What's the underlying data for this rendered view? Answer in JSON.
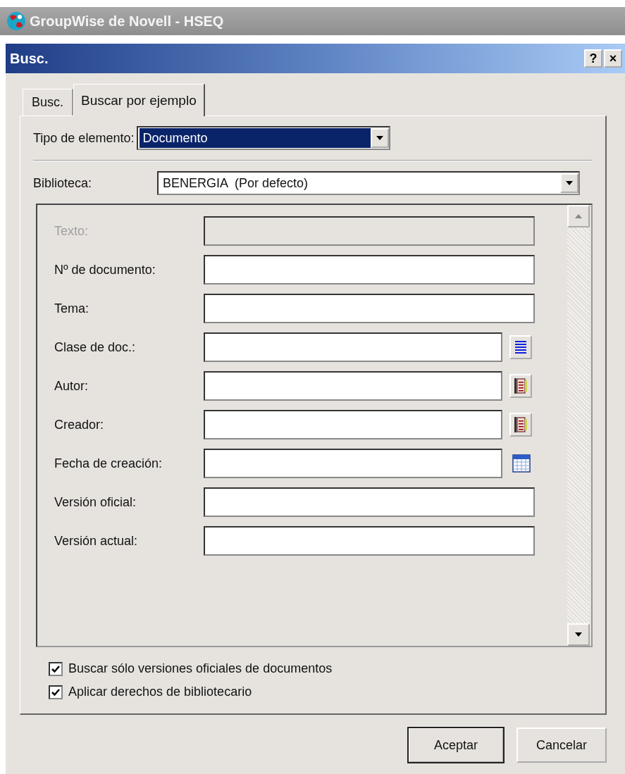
{
  "app_title": "GroupWise de Novell - HSEQ",
  "dialog": {
    "title": "Busc.",
    "help": "?",
    "close": "×"
  },
  "tabs": [
    {
      "label": "Busc.",
      "selected": false
    },
    {
      "label": "Buscar por ejemplo",
      "selected": true
    }
  ],
  "item_type": {
    "label": "Tipo de elemento:",
    "value": "Documento"
  },
  "library": {
    "label": "Biblioteca:",
    "value": "BENERGIA  (Por defecto)"
  },
  "fields": [
    {
      "label": "Texto:",
      "kind": "plain",
      "disabled": true
    },
    {
      "label": "Nº de documento:",
      "kind": "plain",
      "disabled": false
    },
    {
      "label": "Tema:",
      "kind": "plain",
      "disabled": false
    },
    {
      "label": "Clase de doc.:",
      "kind": "list",
      "disabled": false
    },
    {
      "label": "Autor:",
      "kind": "book",
      "disabled": false
    },
    {
      "label": "Creador:",
      "kind": "book",
      "disabled": false
    },
    {
      "label": "Fecha de creación:",
      "kind": "calendar",
      "disabled": false
    },
    {
      "label": "Versión oficial:",
      "kind": "plain",
      "disabled": false
    },
    {
      "label": "Versión actual:",
      "kind": "plain",
      "disabled": false
    }
  ],
  "options": [
    {
      "label": "Buscar sólo versiones oficiales de documentos",
      "checked": true
    },
    {
      "label": "Aplicar derechos de bibliotecario",
      "checked": true
    }
  ],
  "buttons": [
    {
      "label": "Aceptar",
      "kind": "default"
    },
    {
      "label": "Cancelar",
      "kind": "normal"
    }
  ]
}
